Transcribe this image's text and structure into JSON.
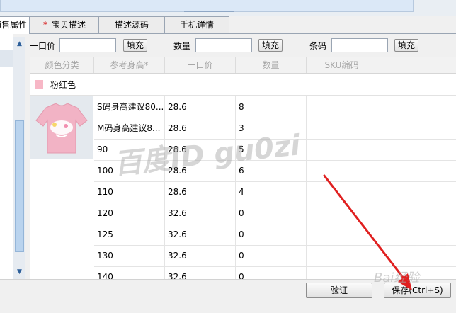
{
  "tabs": [
    {
      "label": "销售属性",
      "active": true,
      "required": false
    },
    {
      "label": "宝贝描述",
      "active": false,
      "required": true
    },
    {
      "label": "描述源码",
      "active": false,
      "required": false
    },
    {
      "label": "手机详情",
      "active": false,
      "required": false
    }
  ],
  "fill_controls": {
    "price_label": "一口价",
    "quantity_label": "数量",
    "barcode_label": "条码",
    "fill_button": "填充"
  },
  "grid": {
    "headers": [
      "颜色分类",
      "参考身高*",
      "一口价",
      "数量",
      "SKU编码"
    ],
    "group": {
      "name": "粉红色",
      "swatch_color": "#f7b7c6"
    },
    "rows": [
      {
        "size": "S码身高建议80...",
        "price": "28.6",
        "qty": "8",
        "sku": ""
      },
      {
        "size": "M码身高建议8...",
        "price": "28.6",
        "qty": "3",
        "sku": ""
      },
      {
        "size": "90",
        "price": "28.6",
        "qty": "5",
        "sku": ""
      },
      {
        "size": "100",
        "price": "28.6",
        "qty": "6",
        "sku": ""
      },
      {
        "size": "110",
        "price": "28.6",
        "qty": "4",
        "sku": ""
      },
      {
        "size": "120",
        "price": "32.6",
        "qty": "0",
        "sku": ""
      },
      {
        "size": "125",
        "price": "32.6",
        "qty": "0",
        "sku": ""
      },
      {
        "size": "130",
        "price": "32.6",
        "qty": "0",
        "sku": ""
      },
      {
        "size": "140",
        "price": "32.6",
        "qty": "0",
        "sku": ""
      }
    ]
  },
  "watermark": "百度ID gu0zi",
  "footer": {
    "verify_button": "验证",
    "save_button": "保存(Ctrl+S)",
    "baidu_watermark": "Bai经验"
  },
  "icons": {
    "scroll_up": "triangle-up-icon",
    "scroll_down": "triangle-down-icon"
  },
  "colors": {
    "arrow": "#e02020",
    "swatch": "#f7b7c6",
    "header_text": "#a6a6a6"
  }
}
